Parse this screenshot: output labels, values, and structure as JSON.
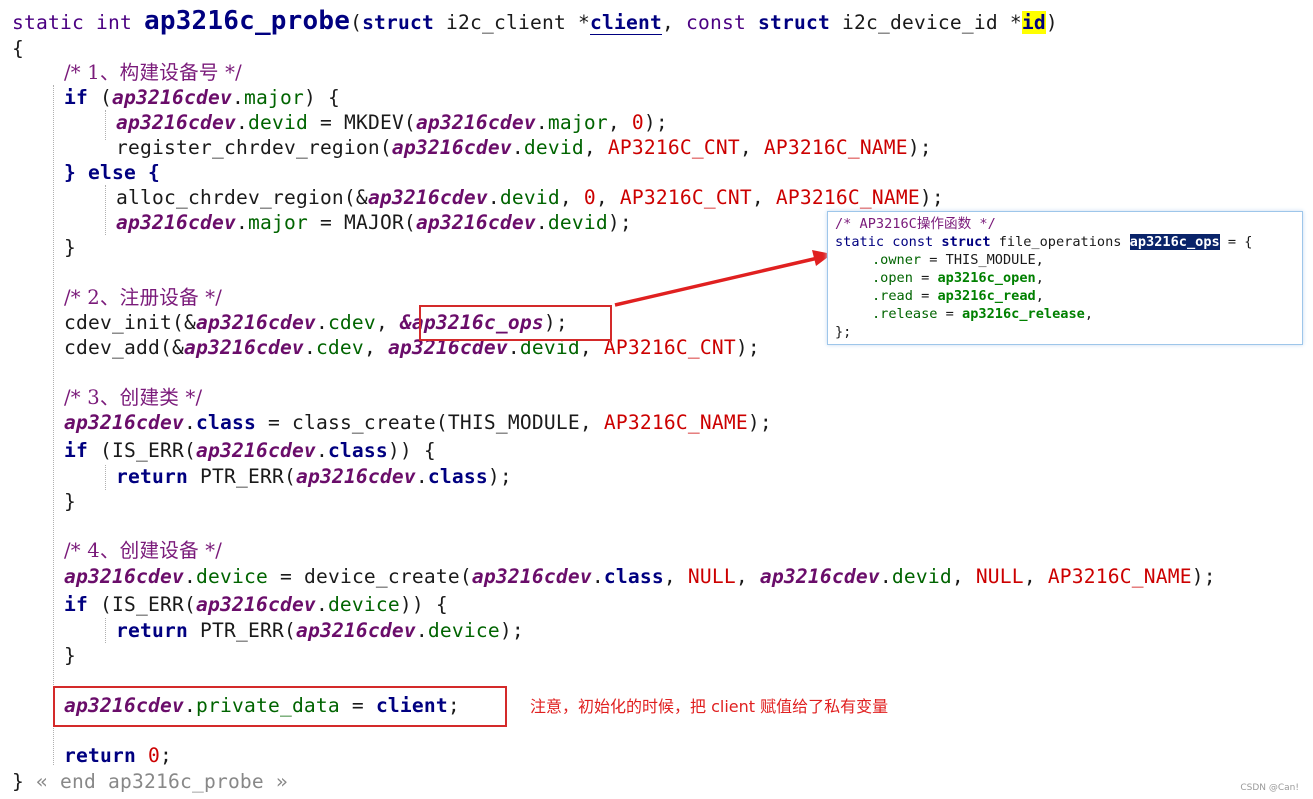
{
  "signature": {
    "prefix": "static int ",
    "function_name": "ap3216c_probe",
    "open_paren": "(",
    "kw_struct1": "struct",
    "type1": " i2c_client *",
    "param1": "client",
    "comma": ", ",
    "kw_const": "const",
    "space": " ",
    "kw_struct2": "struct",
    "type2": " i2c_device_id *",
    "param2": "id",
    "close_paren": ")"
  },
  "code": {
    "open_brace": "{",
    "c1": "/* 1、构建设备号 */",
    "l_if1_kw": "if",
    "l_if1_a": " (",
    "var": "ap3216cdev",
    "dot": ".",
    "major": "major",
    "l_if1_b": ") {",
    "devid": "devid",
    "eq": " = ",
    "mkdev": "MKDEV(",
    "comma": ", ",
    "zero": "0",
    "close_semi": ");",
    "register": "register_chrdev_region(",
    "cnt": "AP3216C_CNT",
    "name": "AP3216C_NAME",
    "else_line": "} else {",
    "alloc": "alloc_chrdev_region(&",
    "major_fn": "MAJOR(",
    "close_brace": "}",
    "c2": "/* 2、注册设备 */",
    "cdev_init": "cdev_init(&",
    "cdev": "cdev",
    "ops_ref": "&ap3216c_ops",
    "cdev_add": "cdev_add(&",
    "c3": "/* 3、创建类 */",
    "class": "class",
    "class_create": "class_create(THIS_MODULE, ",
    "if_iserr": "if",
    "iserr": " (IS_ERR(",
    "iserr_close": ")) {",
    "return_kw": "return",
    "ptr_err": " PTR_ERR(",
    "c4": "/* 4、创建设备 */",
    "device": "device",
    "device_create": "device_create(",
    "null": "NULL",
    "private_data": "private_data",
    "client": "client",
    "semi": ";",
    "return_zero_tail": ";",
    "end_marker": " « end ap3216c_probe »"
  },
  "annotation": {
    "note": "注意，初始化的时候，把 client 赋值给了私有变量"
  },
  "popup": {
    "comment": "/* AP3216C操作函数 */",
    "decl_static": "static const ",
    "decl_struct": "struct",
    "decl_type": " file_operations ",
    "decl_name": "ap3216c_ops",
    "decl_tail": " = {",
    "owner_field": ".owner",
    "owner_val": " = THIS_MODULE,",
    "open_field": ".open",
    "open_eq": " = ",
    "open_val": "ap3216c_open",
    "read_field": ".read",
    "read_val": "ap3216c_read",
    "release_field": ".release",
    "release_val": "ap3216c_release",
    "comma": ",",
    "close": "};"
  },
  "watermark": "CSDN @Can!",
  "colors": {
    "annotation_red": "#d42a2a",
    "popup_border": "#9ec6ea",
    "selection": "#0a246a",
    "highlight": "#ffff00"
  }
}
